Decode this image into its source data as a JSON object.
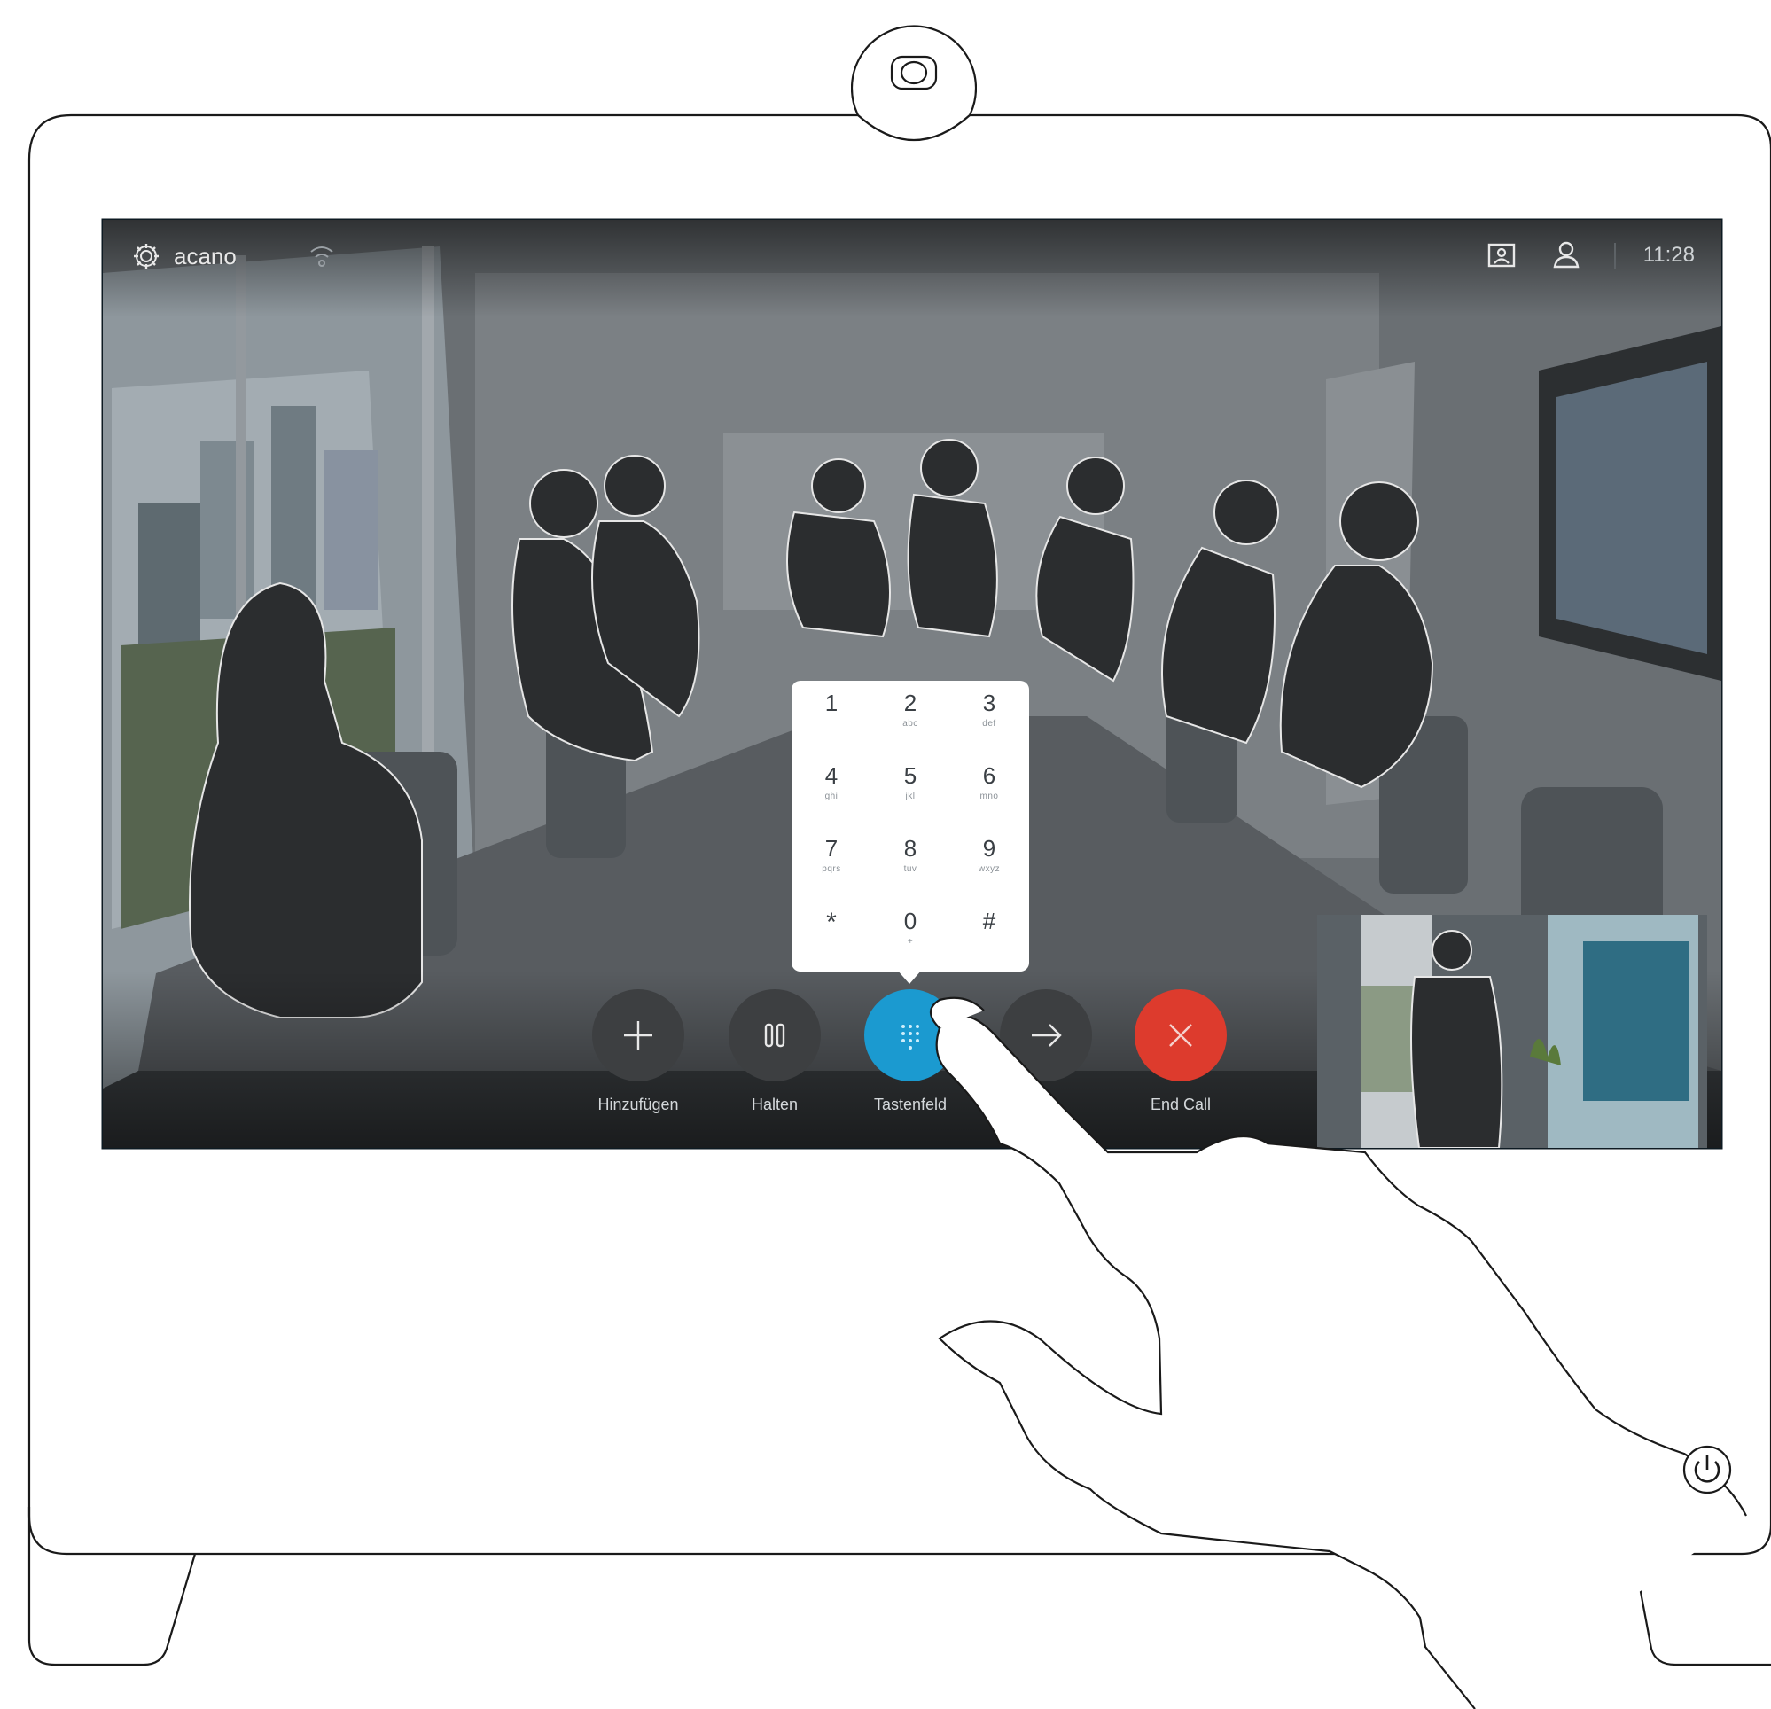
{
  "status_bar": {
    "system_name": "acano",
    "settings_icon": "gear-icon",
    "wifi_icon": "wifi-icon",
    "layout_icon": "layout-icon",
    "contacts_icon": "person-icon",
    "time": "11:28"
  },
  "keypad": {
    "keys": [
      {
        "digit": "1",
        "letters": ""
      },
      {
        "digit": "2",
        "letters": "abc"
      },
      {
        "digit": "3",
        "letters": "def"
      },
      {
        "digit": "4",
        "letters": "ghi"
      },
      {
        "digit": "5",
        "letters": "jkl"
      },
      {
        "digit": "6",
        "letters": "mno"
      },
      {
        "digit": "7",
        "letters": "pqrs"
      },
      {
        "digit": "8",
        "letters": "tuv"
      },
      {
        "digit": "9",
        "letters": "wxyz"
      },
      {
        "digit": "*",
        "letters": ""
      },
      {
        "digit": "0",
        "letters": "+"
      },
      {
        "digit": "#",
        "letters": ""
      }
    ]
  },
  "call_controls": {
    "add_label": "Hinzufügen",
    "hold_label": "Halten",
    "keypad_label": "Tastenfeld",
    "transfer_label": "",
    "end_label": "End Call",
    "colors": {
      "neutral": "#3d3f41",
      "active": "#1b9ad0",
      "end": "#dd3b2d"
    }
  },
  "device": {
    "camera_icon": "camera-icon",
    "power_icon": "power-icon"
  }
}
